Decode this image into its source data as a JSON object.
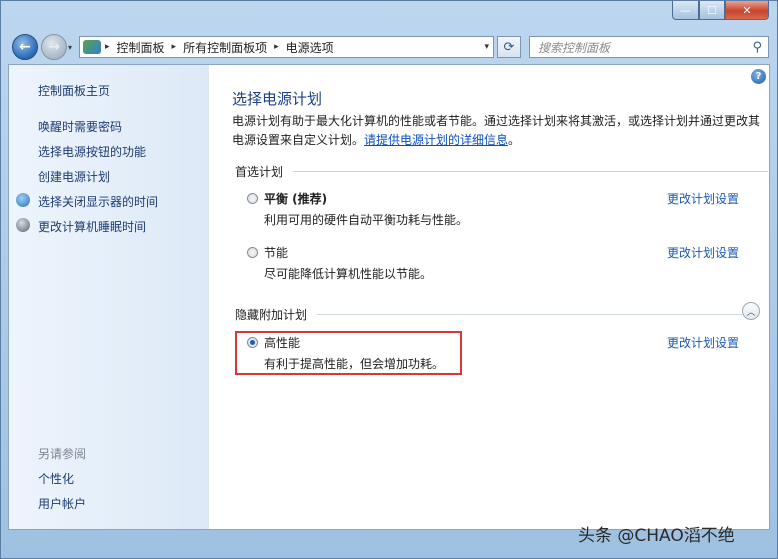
{
  "window": {
    "buttons": {
      "minimize": "—",
      "maximize": "☐",
      "close": "✕"
    }
  },
  "navbar": {
    "back_glyph": "←",
    "forward_glyph": "→",
    "history_dropdown": "▾",
    "breadcrumbs": [
      "控制面板",
      "所有控制面板项",
      "电源选项"
    ],
    "separator": "▸",
    "address_dropdown": "▾",
    "refresh_glyph": "⟳",
    "search_placeholder": "搜索控制面板",
    "search_glyph": "⚲"
  },
  "sidebar": {
    "home": "控制面板主页",
    "links": [
      "唤醒时需要密码",
      "选择电源按钮的功能",
      "创建电源计划",
      "选择关闭显示器的时间",
      "更改计算机睡眠时间"
    ],
    "see_also_heading": "另请参阅",
    "see_also": [
      "个性化",
      "用户帐户"
    ]
  },
  "main": {
    "help_glyph": "?",
    "title": "选择电源计划",
    "description_line1": "电源计划有助于最大化计算机的性能或者节能。通过选择计划来将其激活，或选择计划并通过更改其",
    "description_line2_prefix": "电源设置来自定义计划。",
    "description_link": "请提供电源计划的详细信息",
    "description_suffix": "。",
    "preferred_heading": "首选计划",
    "hidden_heading": "隐藏附加计划",
    "collapse_glyph": "︿",
    "plans": [
      {
        "name": "平衡 (推荐)",
        "desc": "利用可用的硬件自动平衡功耗与性能。",
        "change": "更改计划设置",
        "selected": false
      },
      {
        "name": "节能",
        "desc": "尽可能降低计算机性能以节能。",
        "change": "更改计划设置",
        "selected": false
      },
      {
        "name": "高性能",
        "desc": "有利于提高性能，但会增加功耗。",
        "change": "更改计划设置",
        "selected": true
      }
    ]
  },
  "watermark": "头条 @CHAO滔不绝",
  "colors": {
    "accent": "#1a58b6",
    "highlight_border": "#d9383a",
    "title": "#1b3f86"
  }
}
